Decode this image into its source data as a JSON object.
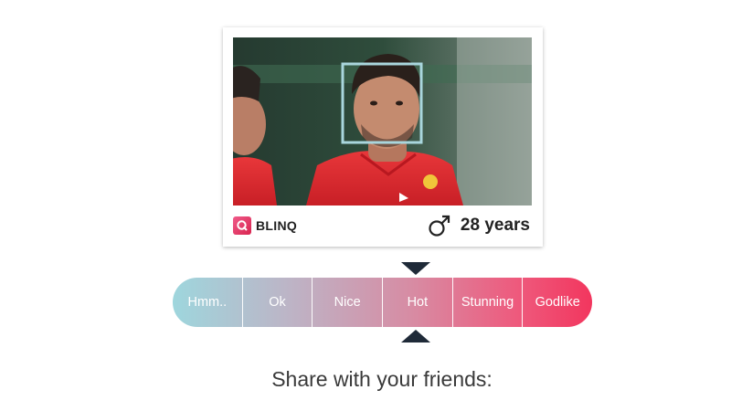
{
  "brand": {
    "name": "BLINQ",
    "mark_letter": "Q"
  },
  "photo": {
    "subject": "face-detected-photo"
  },
  "result": {
    "gender_icon": "male-symbol-icon",
    "age": "28 years"
  },
  "rating": {
    "options": [
      "Hmm..",
      "Ok",
      "Nice",
      "Hot",
      "Stunning",
      "Godlike"
    ],
    "selected": "Hot",
    "selected_index": 3
  },
  "share": {
    "label": "Share with your friends:"
  },
  "colors": {
    "gradient_start": "#9ed6dd",
    "gradient_end": "#f2365e",
    "marker": "#1f2a38",
    "face_box": "#a9d6dd"
  }
}
